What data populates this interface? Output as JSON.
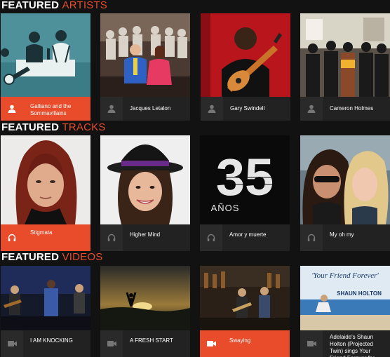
{
  "sections": {
    "artists": {
      "title_plain": "FEATURED",
      "title_accent": "ARTISTS"
    },
    "tracks": {
      "title_plain": "FEATURED",
      "title_accent": "TRACKS"
    },
    "videos": {
      "title_plain": "FEATURED",
      "title_accent": "VIDEOS"
    }
  },
  "artists": [
    {
      "name": "Galliano and the Sommavillains",
      "icon": "user-icon",
      "active": true
    },
    {
      "name": "Jacques Letalon",
      "icon": "user-icon",
      "active": false
    },
    {
      "name": "Gary Swindell",
      "icon": "user-icon",
      "active": false
    },
    {
      "name": "Cameron Holmes",
      "icon": "user-icon",
      "active": false
    }
  ],
  "tracks": [
    {
      "title": "Stigmata",
      "icon": "headphones-icon",
      "active": true
    },
    {
      "title": "Higher Mind",
      "icon": "headphones-icon",
      "active": false
    },
    {
      "title": "Amor y muerte",
      "icon": "headphones-icon",
      "active": false,
      "artwork_number": "35",
      "artwork_text": "AÑOS"
    },
    {
      "title": "My oh my",
      "icon": "headphones-icon",
      "active": false
    }
  ],
  "videos": [
    {
      "title": "I AM KNOCKING",
      "icon": "video-camera-icon",
      "active": false
    },
    {
      "title": "A FRESH START",
      "icon": "video-camera-icon",
      "active": false
    },
    {
      "title": "Swaying",
      "icon": "video-camera-icon",
      "active": true
    },
    {
      "title": "Adelaide's Shaun Holton (Projected Twin) sings Your Friend Forever for Hilton",
      "icon": "video-camera-icon",
      "active": false,
      "artwork_title": "'Your Friend Forever'",
      "artwork_sub": "SHAUN HOLTON"
    }
  ],
  "colors": {
    "accent": "#e84c2b",
    "background": "#121212",
    "card": "#222222"
  }
}
